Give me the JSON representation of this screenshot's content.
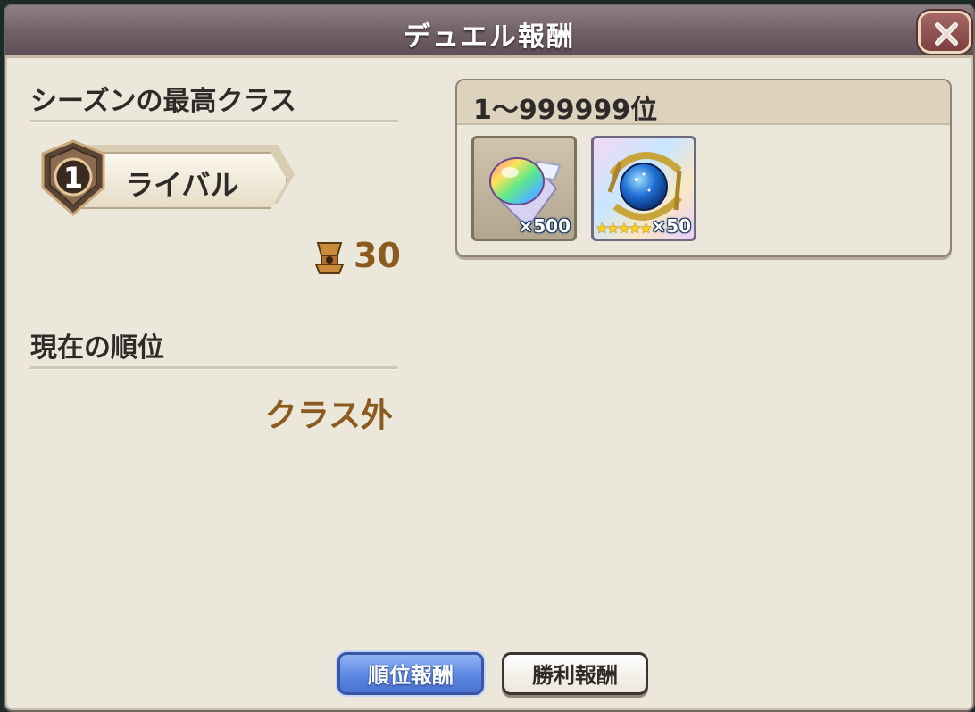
{
  "dialog": {
    "title": "デュエル報酬",
    "close_icon": "close-x-icon"
  },
  "season_best": {
    "label": "シーズンの最高クラス",
    "rank_number": "1",
    "rank_name": "ライバル",
    "trophy_icon": "trophy-icon",
    "trophy_value": "30"
  },
  "current": {
    "label": "現在の順位",
    "value": "クラス外"
  },
  "reward": {
    "range": "1〜999999位",
    "items": [
      {
        "icon": "rainbow-crystal-icon",
        "quantity": "×500"
      },
      {
        "icon": "astral-sphere-icon",
        "stars": "★★★★★",
        "quantity": "×50"
      }
    ]
  },
  "tabs": {
    "rank_reward": "順位報酬",
    "win_reward": "勝利報酬"
  },
  "colors": {
    "title_bar": "#7a6a70",
    "accent_brown": "#8a5a1e",
    "active_tab": "#5b84e0"
  }
}
